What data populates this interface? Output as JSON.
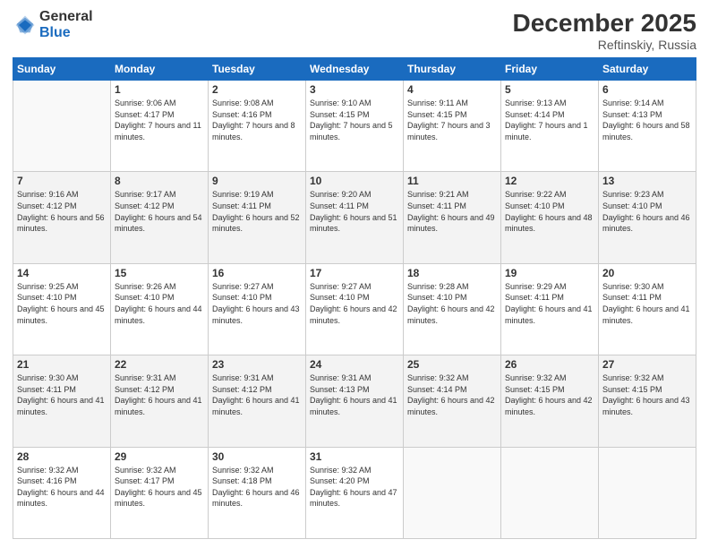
{
  "logo": {
    "general": "General",
    "blue": "Blue"
  },
  "header": {
    "month": "December 2025",
    "location": "Reftinskiy, Russia"
  },
  "weekdays": [
    "Sunday",
    "Monday",
    "Tuesday",
    "Wednesday",
    "Thursday",
    "Friday",
    "Saturday"
  ],
  "weeks": [
    [
      {
        "day": "",
        "sunrise": "",
        "sunset": "",
        "daylight": ""
      },
      {
        "day": "1",
        "sunrise": "Sunrise: 9:06 AM",
        "sunset": "Sunset: 4:17 PM",
        "daylight": "Daylight: 7 hours and 11 minutes."
      },
      {
        "day": "2",
        "sunrise": "Sunrise: 9:08 AM",
        "sunset": "Sunset: 4:16 PM",
        "daylight": "Daylight: 7 hours and 8 minutes."
      },
      {
        "day": "3",
        "sunrise": "Sunrise: 9:10 AM",
        "sunset": "Sunset: 4:15 PM",
        "daylight": "Daylight: 7 hours and 5 minutes."
      },
      {
        "day": "4",
        "sunrise": "Sunrise: 9:11 AM",
        "sunset": "Sunset: 4:15 PM",
        "daylight": "Daylight: 7 hours and 3 minutes."
      },
      {
        "day": "5",
        "sunrise": "Sunrise: 9:13 AM",
        "sunset": "Sunset: 4:14 PM",
        "daylight": "Daylight: 7 hours and 1 minute."
      },
      {
        "day": "6",
        "sunrise": "Sunrise: 9:14 AM",
        "sunset": "Sunset: 4:13 PM",
        "daylight": "Daylight: 6 hours and 58 minutes."
      }
    ],
    [
      {
        "day": "7",
        "sunrise": "Sunrise: 9:16 AM",
        "sunset": "Sunset: 4:12 PM",
        "daylight": "Daylight: 6 hours and 56 minutes."
      },
      {
        "day": "8",
        "sunrise": "Sunrise: 9:17 AM",
        "sunset": "Sunset: 4:12 PM",
        "daylight": "Daylight: 6 hours and 54 minutes."
      },
      {
        "day": "9",
        "sunrise": "Sunrise: 9:19 AM",
        "sunset": "Sunset: 4:11 PM",
        "daylight": "Daylight: 6 hours and 52 minutes."
      },
      {
        "day": "10",
        "sunrise": "Sunrise: 9:20 AM",
        "sunset": "Sunset: 4:11 PM",
        "daylight": "Daylight: 6 hours and 51 minutes."
      },
      {
        "day": "11",
        "sunrise": "Sunrise: 9:21 AM",
        "sunset": "Sunset: 4:11 PM",
        "daylight": "Daylight: 6 hours and 49 minutes."
      },
      {
        "day": "12",
        "sunrise": "Sunrise: 9:22 AM",
        "sunset": "Sunset: 4:10 PM",
        "daylight": "Daylight: 6 hours and 48 minutes."
      },
      {
        "day": "13",
        "sunrise": "Sunrise: 9:23 AM",
        "sunset": "Sunset: 4:10 PM",
        "daylight": "Daylight: 6 hours and 46 minutes."
      }
    ],
    [
      {
        "day": "14",
        "sunrise": "Sunrise: 9:25 AM",
        "sunset": "Sunset: 4:10 PM",
        "daylight": "Daylight: 6 hours and 45 minutes."
      },
      {
        "day": "15",
        "sunrise": "Sunrise: 9:26 AM",
        "sunset": "Sunset: 4:10 PM",
        "daylight": "Daylight: 6 hours and 44 minutes."
      },
      {
        "day": "16",
        "sunrise": "Sunrise: 9:27 AM",
        "sunset": "Sunset: 4:10 PM",
        "daylight": "Daylight: 6 hours and 43 minutes."
      },
      {
        "day": "17",
        "sunrise": "Sunrise: 9:27 AM",
        "sunset": "Sunset: 4:10 PM",
        "daylight": "Daylight: 6 hours and 42 minutes."
      },
      {
        "day": "18",
        "sunrise": "Sunrise: 9:28 AM",
        "sunset": "Sunset: 4:10 PM",
        "daylight": "Daylight: 6 hours and 42 minutes."
      },
      {
        "day": "19",
        "sunrise": "Sunrise: 9:29 AM",
        "sunset": "Sunset: 4:11 PM",
        "daylight": "Daylight: 6 hours and 41 minutes."
      },
      {
        "day": "20",
        "sunrise": "Sunrise: 9:30 AM",
        "sunset": "Sunset: 4:11 PM",
        "daylight": "Daylight: 6 hours and 41 minutes."
      }
    ],
    [
      {
        "day": "21",
        "sunrise": "Sunrise: 9:30 AM",
        "sunset": "Sunset: 4:11 PM",
        "daylight": "Daylight: 6 hours and 41 minutes."
      },
      {
        "day": "22",
        "sunrise": "Sunrise: 9:31 AM",
        "sunset": "Sunset: 4:12 PM",
        "daylight": "Daylight: 6 hours and 41 minutes."
      },
      {
        "day": "23",
        "sunrise": "Sunrise: 9:31 AM",
        "sunset": "Sunset: 4:12 PM",
        "daylight": "Daylight: 6 hours and 41 minutes."
      },
      {
        "day": "24",
        "sunrise": "Sunrise: 9:31 AM",
        "sunset": "Sunset: 4:13 PM",
        "daylight": "Daylight: 6 hours and 41 minutes."
      },
      {
        "day": "25",
        "sunrise": "Sunrise: 9:32 AM",
        "sunset": "Sunset: 4:14 PM",
        "daylight": "Daylight: 6 hours and 42 minutes."
      },
      {
        "day": "26",
        "sunrise": "Sunrise: 9:32 AM",
        "sunset": "Sunset: 4:15 PM",
        "daylight": "Daylight: 6 hours and 42 minutes."
      },
      {
        "day": "27",
        "sunrise": "Sunrise: 9:32 AM",
        "sunset": "Sunset: 4:15 PM",
        "daylight": "Daylight: 6 hours and 43 minutes."
      }
    ],
    [
      {
        "day": "28",
        "sunrise": "Sunrise: 9:32 AM",
        "sunset": "Sunset: 4:16 PM",
        "daylight": "Daylight: 6 hours and 44 minutes."
      },
      {
        "day": "29",
        "sunrise": "Sunrise: 9:32 AM",
        "sunset": "Sunset: 4:17 PM",
        "daylight": "Daylight: 6 hours and 45 minutes."
      },
      {
        "day": "30",
        "sunrise": "Sunrise: 9:32 AM",
        "sunset": "Sunset: 4:18 PM",
        "daylight": "Daylight: 6 hours and 46 minutes."
      },
      {
        "day": "31",
        "sunrise": "Sunrise: 9:32 AM",
        "sunset": "Sunset: 4:20 PM",
        "daylight": "Daylight: 6 hours and 47 minutes."
      },
      {
        "day": "",
        "sunrise": "",
        "sunset": "",
        "daylight": ""
      },
      {
        "day": "",
        "sunrise": "",
        "sunset": "",
        "daylight": ""
      },
      {
        "day": "",
        "sunrise": "",
        "sunset": "",
        "daylight": ""
      }
    ]
  ]
}
